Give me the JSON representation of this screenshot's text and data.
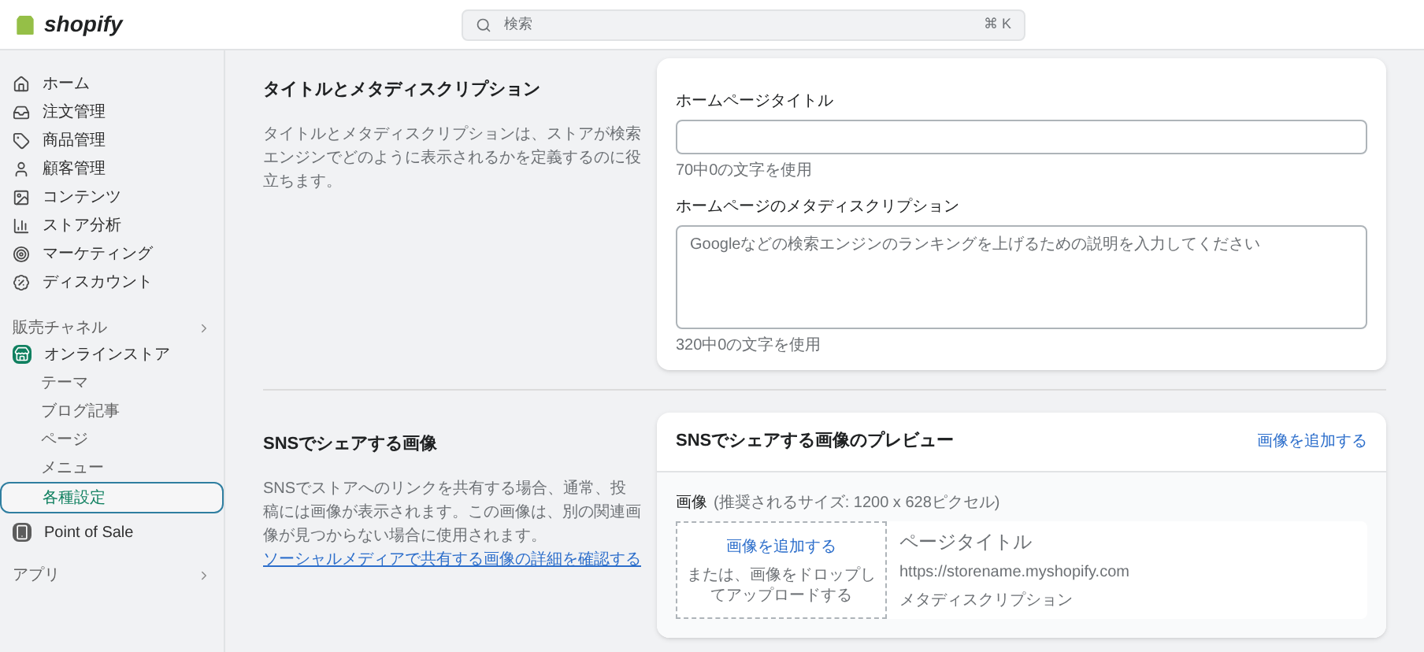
{
  "topbar": {
    "logo": "shopify",
    "search": {
      "placeholder": "検索",
      "shortcut": "⌘ K"
    }
  },
  "sidebar": {
    "items": [
      {
        "label": "ホーム"
      },
      {
        "label": "注文管理"
      },
      {
        "label": "商品管理"
      },
      {
        "label": "顧客管理"
      },
      {
        "label": "コンテンツ"
      },
      {
        "label": "ストア分析"
      },
      {
        "label": "マーケティング"
      },
      {
        "label": "ディスカウント"
      }
    ],
    "channels_heading": "販売チャネル",
    "online_store": {
      "label": "オンラインストア",
      "children": [
        {
          "label": "テーマ",
          "selected": false
        },
        {
          "label": "ブログ記事",
          "selected": false
        },
        {
          "label": "ページ",
          "selected": false
        },
        {
          "label": "メニュー",
          "selected": false
        },
        {
          "label": "各種設定",
          "selected": true
        }
      ]
    },
    "pos": "Point of Sale",
    "apps_heading": "アプリ"
  },
  "sections": [
    {
      "kind": "meta",
      "title": "タイトルとメタディスクリプション",
      "description": "タイトルとメタディスクリプションは、ストアが検索エンジンでどのように表示されるかを定義するのに役立ちます。",
      "title_label": "ホームページタイトル",
      "title_count": "70中0の文字を使用",
      "desc_label": "ホームページのメタディスクリプション",
      "desc_placeholder": "Googleなどの検索エンジンのランキングを上げるための説明を入力してください",
      "desc_count": "320中0の文字を使用"
    },
    {
      "kind": "social",
      "title": "SNSでシェアする画像",
      "description": "SNSでストアへのリンクを共有する場合、通常、投稿には画像が表示されます。この画像は、別の関連画像が見つからない場合に使用されます。",
      "link": "ソーシャルメディアで共有する画像の詳細を確認する",
      "card_title": "SNSでシェアする画像のプレビュー",
      "card_action": "画像を追加する",
      "image_label": "画像",
      "image_hint": "(推奨されるサイズ: 1200 x 628ピクセル)",
      "upload_link": "画像を追加する",
      "upload_hint": "または、画像をドロップしてアップロードする",
      "preview_title": "ページタイトル",
      "preview_url": "https://storename.myshopify.com",
      "preview_desc": "メタディスクリプション"
    }
  ]
}
